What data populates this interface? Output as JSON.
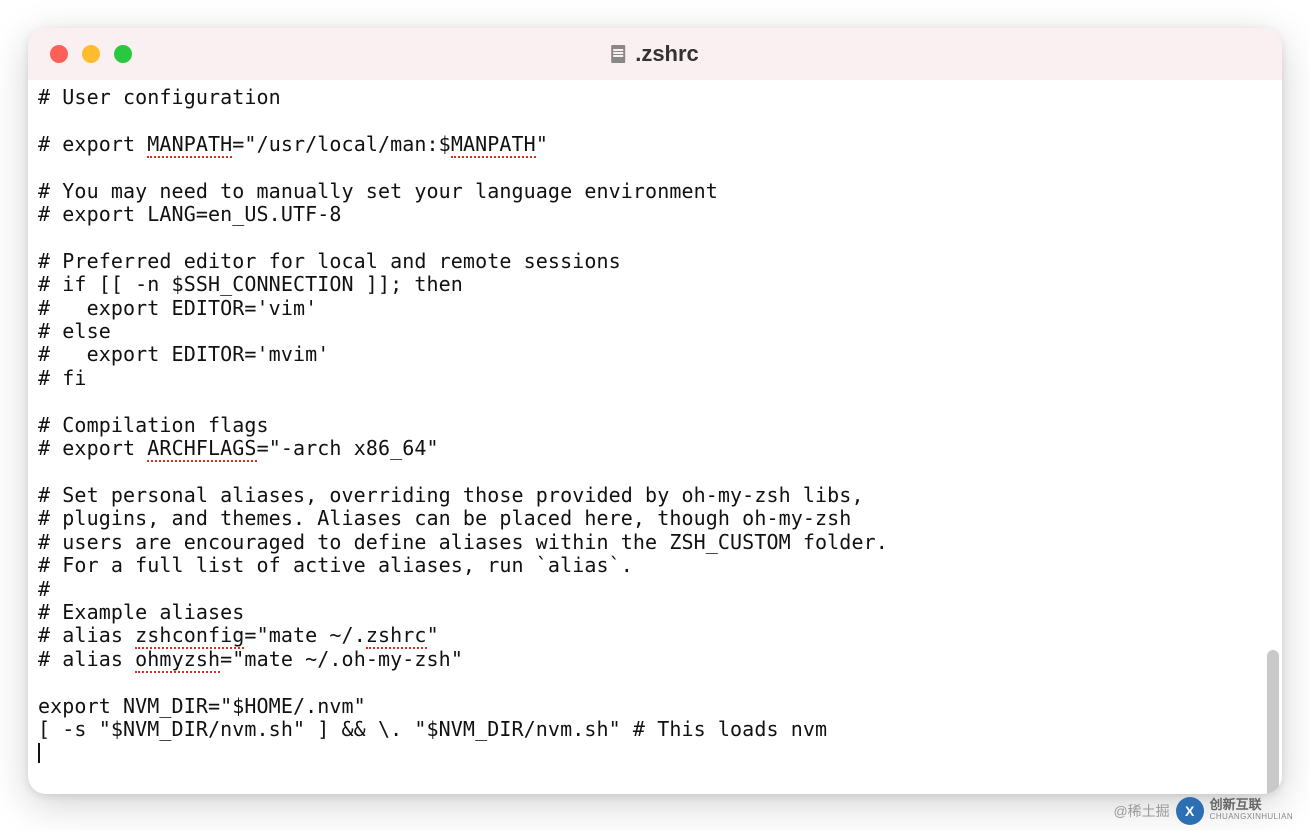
{
  "window": {
    "title": ".zshrc"
  },
  "editor": {
    "spellcheck_words": [
      "MANPATH",
      "MANPATH",
      "ARCHFLAGS",
      "zshconfig",
      "zshrc",
      "ohmyzsh"
    ],
    "lines": [
      "# User configuration",
      "",
      "# export MANPATH=\"/usr/local/man:$MANPATH\"",
      "",
      "# You may need to manually set your language environment",
      "# export LANG=en_US.UTF-8",
      "",
      "# Preferred editor for local and remote sessions",
      "# if [[ -n $SSH_CONNECTION ]]; then",
      "#   export EDITOR='vim'",
      "# else",
      "#   export EDITOR='mvim'",
      "# fi",
      "",
      "# Compilation flags",
      "# export ARCHFLAGS=\"-arch x86_64\"",
      "",
      "# Set personal aliases, overriding those provided by oh-my-zsh libs,",
      "# plugins, and themes. Aliases can be placed here, though oh-my-zsh",
      "# users are encouraged to define aliases within the ZSH_CUSTOM folder.",
      "# For a full list of active aliases, run `alias`.",
      "#",
      "# Example aliases",
      "# alias zshconfig=\"mate ~/.zshrc\"",
      "# alias ohmyzsh=\"mate ~/.oh-my-zsh\"",
      "",
      "export NVM_DIR=\"$HOME/.nvm\"",
      "[ -s \"$NVM_DIR/nvm.sh\" ] && \\. \"$NVM_DIR/nvm.sh\" # This loads nvm"
    ]
  },
  "watermark": {
    "text1": "@稀土掘",
    "text2_top": "创新互联",
    "text2_bottom": "CHUANGXINHULIAN"
  }
}
